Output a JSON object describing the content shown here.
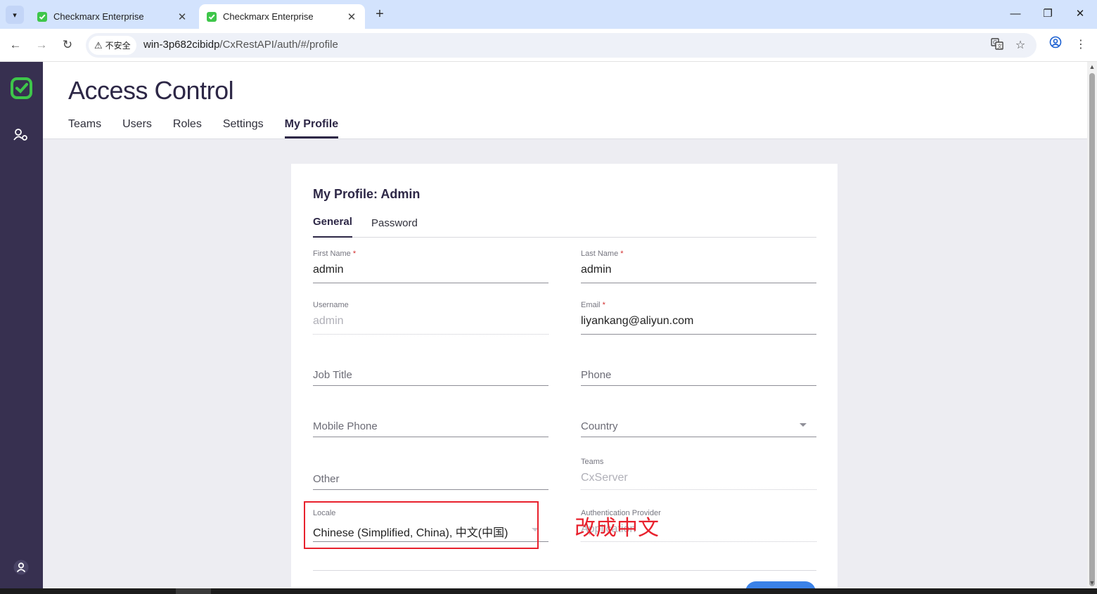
{
  "browser": {
    "tabs": [
      {
        "title": "Checkmarx Enterprise",
        "active": false
      },
      {
        "title": "Checkmarx Enterprise",
        "active": true
      }
    ],
    "security_label": "不安全",
    "url_host": "win-3p682cibidp",
    "url_path": "/CxRestAPI/auth/#/profile"
  },
  "app": {
    "page_title": "Access Control",
    "main_tabs": [
      "Teams",
      "Users",
      "Roles",
      "Settings",
      "My Profile"
    ],
    "active_tab": "My Profile",
    "accent_color": "#2d2746",
    "sidebar_color": "#373050",
    "logo_color": "#3ec64a"
  },
  "profile": {
    "title": "My Profile: Admin",
    "sub_tabs": [
      "General",
      "Password"
    ],
    "fields": {
      "first_name": {
        "label": "First Name",
        "required": "*",
        "value": "admin"
      },
      "last_name": {
        "label": "Last Name",
        "required": "*",
        "value": "admin"
      },
      "username": {
        "label": "Username",
        "value": "admin"
      },
      "email": {
        "label": "Email",
        "required": "*",
        "value": "liyankang@aliyun.com"
      },
      "job_title": {
        "placeholder": "Job Title"
      },
      "phone": {
        "placeholder": "Phone"
      },
      "mobile_phone": {
        "placeholder": "Mobile Phone"
      },
      "country": {
        "placeholder": "Country"
      },
      "other": {
        "placeholder": "Other"
      },
      "teams": {
        "label": "Teams",
        "value": "CxServer"
      },
      "locale": {
        "label": "Locale",
        "value": "Chinese (Simplified, China), 中文(中国)"
      },
      "auth_provider": {
        "label": "Authentication Provider",
        "value": "Application"
      }
    }
  },
  "annotation": {
    "text": "改成中文",
    "color": "#e8212d"
  }
}
